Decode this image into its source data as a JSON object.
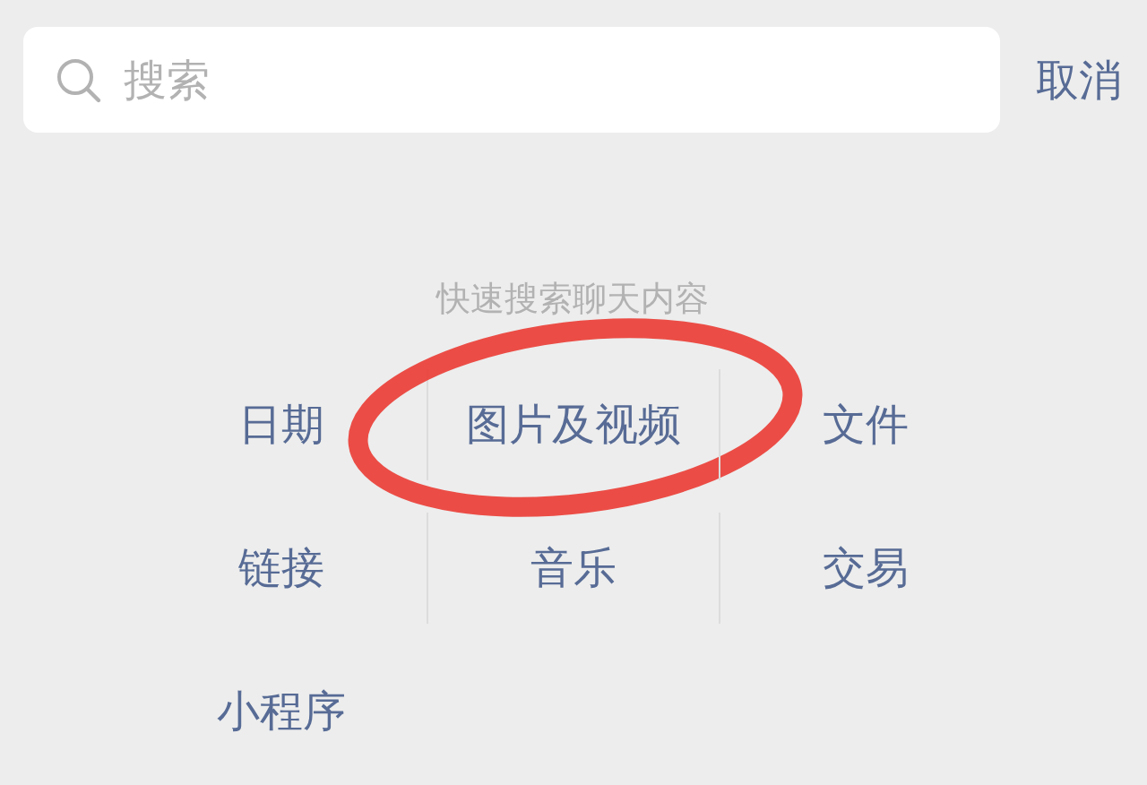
{
  "search": {
    "placeholder": "搜索"
  },
  "cancel": "取消",
  "hint": "快速搜索聊天内容",
  "categories": [
    {
      "label": "日期",
      "highlighted": false
    },
    {
      "label": "图片及视频",
      "highlighted": true
    },
    {
      "label": "文件",
      "highlighted": false
    },
    {
      "label": "链接",
      "highlighted": false
    },
    {
      "label": "音乐",
      "highlighted": false
    },
    {
      "label": "交易",
      "highlighted": false
    },
    {
      "label": "小程序",
      "highlighted": false
    }
  ]
}
